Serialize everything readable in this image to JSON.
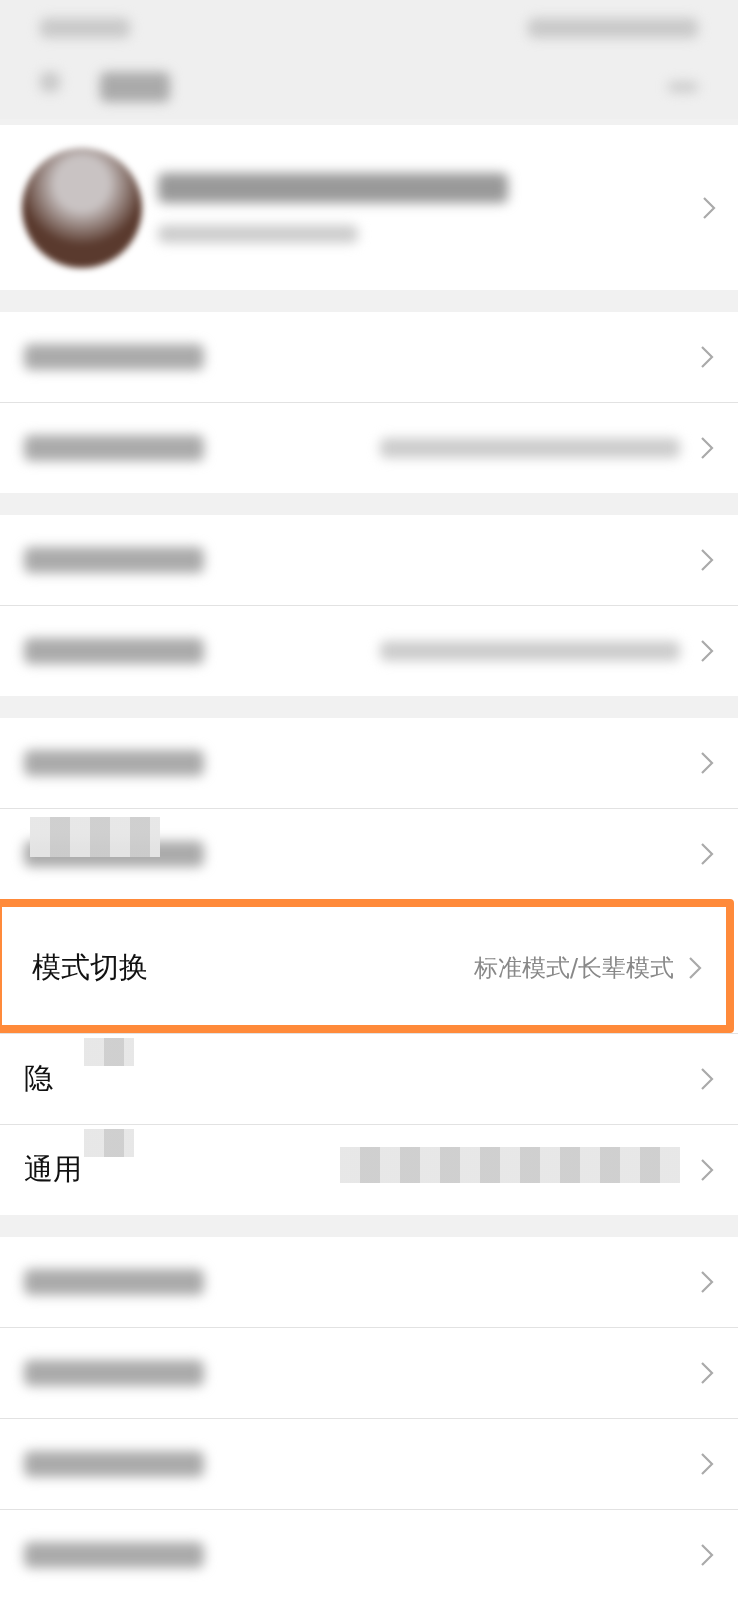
{
  "sections": [
    {
      "items": [
        {
          "kind": "profile"
        }
      ]
    },
    {
      "items": [
        {
          "kind": "blurred"
        },
        {
          "kind": "blurred",
          "value_blurred": true
        }
      ]
    },
    {
      "items": [
        {
          "kind": "blurred"
        },
        {
          "kind": "blurred",
          "value_blurred": true
        }
      ]
    },
    {
      "items": [
        {
          "kind": "blurred"
        },
        {
          "kind": "blurred",
          "mosaic": true
        },
        {
          "kind": "text",
          "label": "模式切换",
          "value": "标准模式/长辈模式",
          "highlighted": true
        },
        {
          "kind": "text",
          "label": "隐",
          "mosaic": true
        },
        {
          "kind": "text",
          "label": "通用",
          "mosaic": true,
          "value_mosaic": true
        }
      ]
    },
    {
      "items": [
        {
          "kind": "blurred"
        },
        {
          "kind": "blurred"
        },
        {
          "kind": "blurred"
        },
        {
          "kind": "blurred"
        }
      ]
    }
  ]
}
